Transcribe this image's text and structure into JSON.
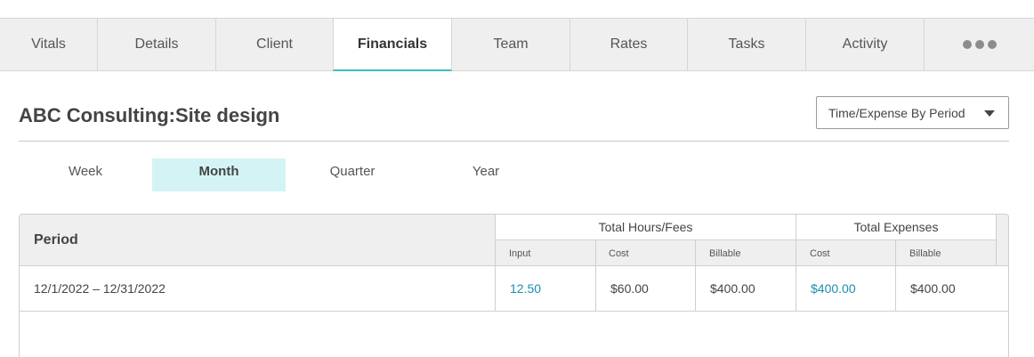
{
  "tabs": [
    {
      "label": "Vitals"
    },
    {
      "label": "Details"
    },
    {
      "label": "Client"
    },
    {
      "label": "Financials",
      "active": true
    },
    {
      "label": "Team"
    },
    {
      "label": "Rates"
    },
    {
      "label": "Tasks"
    },
    {
      "label": "Activity"
    }
  ],
  "more_icon": "more-horizontal-icon",
  "colors": {
    "accent": "#3dbdbd",
    "active_period_bg": "#d4f3f4",
    "link": "#1a8fb0"
  },
  "page": {
    "title": "ABC Consulting:Site design"
  },
  "report_select": {
    "value": "Time/Expense By Period"
  },
  "periods": [
    {
      "label": "Week"
    },
    {
      "label": "Month",
      "active": true
    },
    {
      "label": "Quarter"
    },
    {
      "label": "Year"
    }
  ],
  "table": {
    "period_header": "Period",
    "groups": {
      "hours_fees": "Total Hours/Fees",
      "expenses": "Total Expenses"
    },
    "subheaders": {
      "input": "Input",
      "cost": "Cost",
      "billable": "Billable",
      "exp_cost": "Cost",
      "exp_billable": "Billable"
    },
    "rows": [
      {
        "period": "12/1/2022 – 12/31/2022",
        "input": "12.50",
        "cost": "$60.00",
        "billable": "$400.00",
        "exp_cost": "$400.00",
        "exp_billable": "$400.00"
      }
    ]
  }
}
